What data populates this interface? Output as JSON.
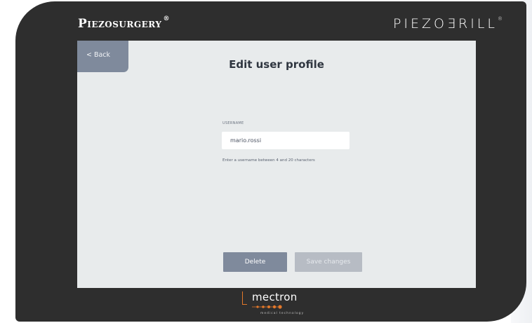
{
  "header": {
    "brand_left": "Piezosurgery",
    "brand_left_reg": "®",
    "brand_right": "PIEZOƎRILL",
    "brand_right_reg": "®"
  },
  "nav": {
    "back_label": "Back",
    "back_icon": "chevron-left-icon"
  },
  "page": {
    "title": "Edit user profile"
  },
  "form": {
    "username_label": "USERNAME",
    "username_value": "mario.rossi",
    "username_help": "Enter a username between 4 and 20 characters"
  },
  "actions": {
    "delete_label": "Delete",
    "save_label": "Save changes"
  },
  "footer": {
    "brand": "mectron",
    "tagline": "medical technology"
  },
  "colors": {
    "device": "#2e2e2e",
    "screen": "#e8ebec",
    "primary_button": "#7f8a9c",
    "disabled_button": "#b7bcc4",
    "accent": "#e3782a"
  }
}
